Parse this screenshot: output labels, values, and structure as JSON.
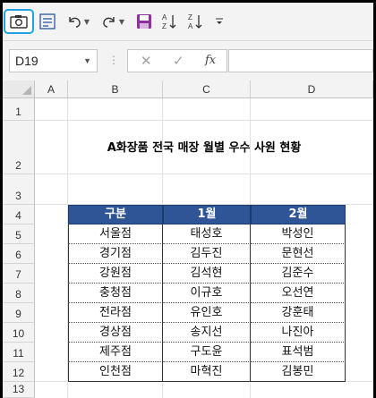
{
  "toolbar": {
    "icons": [
      "camera-icon",
      "form-icon",
      "undo-icon",
      "redo-icon",
      "save-icon",
      "sort-ascending-icon",
      "sort-descending-icon",
      "customize-toolbar-icon"
    ]
  },
  "formula_bar": {
    "name_box": "D19",
    "cancel_symbol": "✕",
    "enter_symbol": "✓",
    "fx_label": "fx",
    "formula": ""
  },
  "columns": [
    "A",
    "B",
    "C",
    "D"
  ],
  "rows": [
    "1",
    "2",
    "3",
    "4",
    "5",
    "6",
    "7",
    "8",
    "9",
    "10",
    "11",
    "12",
    "13"
  ],
  "sheet": {
    "title": "A화장품 전국 매장 월별 우수 사원 현황",
    "table": {
      "headers": [
        "구분",
        "1월",
        "2월"
      ],
      "rows": [
        [
          "서울점",
          "태성호",
          "박성인"
        ],
        [
          "경기점",
          "김두진",
          "문현선"
        ],
        [
          "강원점",
          "김석현",
          "김준수"
        ],
        [
          "충청점",
          "이규호",
          "오선연"
        ],
        [
          "전라점",
          "유인호",
          "강훈태"
        ],
        [
          "경상점",
          "송지선",
          "나진아"
        ],
        [
          "제주점",
          "구도윤",
          "표석범"
        ],
        [
          "인천점",
          "마혁진",
          "김봉민"
        ]
      ]
    }
  },
  "colors": {
    "header_fill": "#2F5597",
    "selected_accent": "#1FA3E3"
  }
}
